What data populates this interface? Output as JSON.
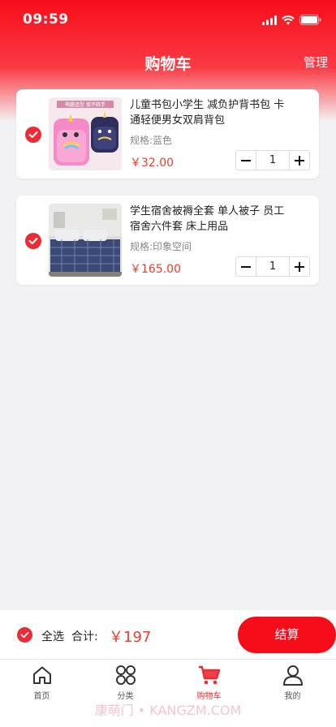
{
  "status_bar": {
    "time": "09:59"
  },
  "header": {
    "title": "购物车",
    "manage_label": "管理"
  },
  "cart_items": [
    {
      "title": "儿童书包小学生 减负护背书包 卡通轻便男女双肩背包",
      "spec": "规格:蓝色",
      "price": "￥32.00",
      "quantity": "1",
      "checked": true,
      "image_caption": "萌趣造型 爱不释手"
    },
    {
      "title": "学生宿舍被褥全套 单人被子 员工宿舍六件套 床上用品",
      "spec": "规格:印象空间",
      "price": "￥165.00",
      "quantity": "1",
      "checked": true
    }
  ],
  "footer": {
    "select_all_label": "全选",
    "total_label": "合计:",
    "total_value": "￥197",
    "checkout_label": "结算"
  },
  "tabbar": {
    "items": [
      {
        "label": "首页",
        "icon": "home-icon"
      },
      {
        "label": "分类",
        "icon": "category-icon"
      },
      {
        "label": "购物车",
        "icon": "cart-icon",
        "active": true
      },
      {
        "label": "我的",
        "icon": "user-icon"
      }
    ]
  },
  "watermark": "康萌门 • KANGZM.COM",
  "colors": {
    "accent": "#f70d1a",
    "price": "#ee3b2a",
    "checked": "#ee2a35"
  }
}
